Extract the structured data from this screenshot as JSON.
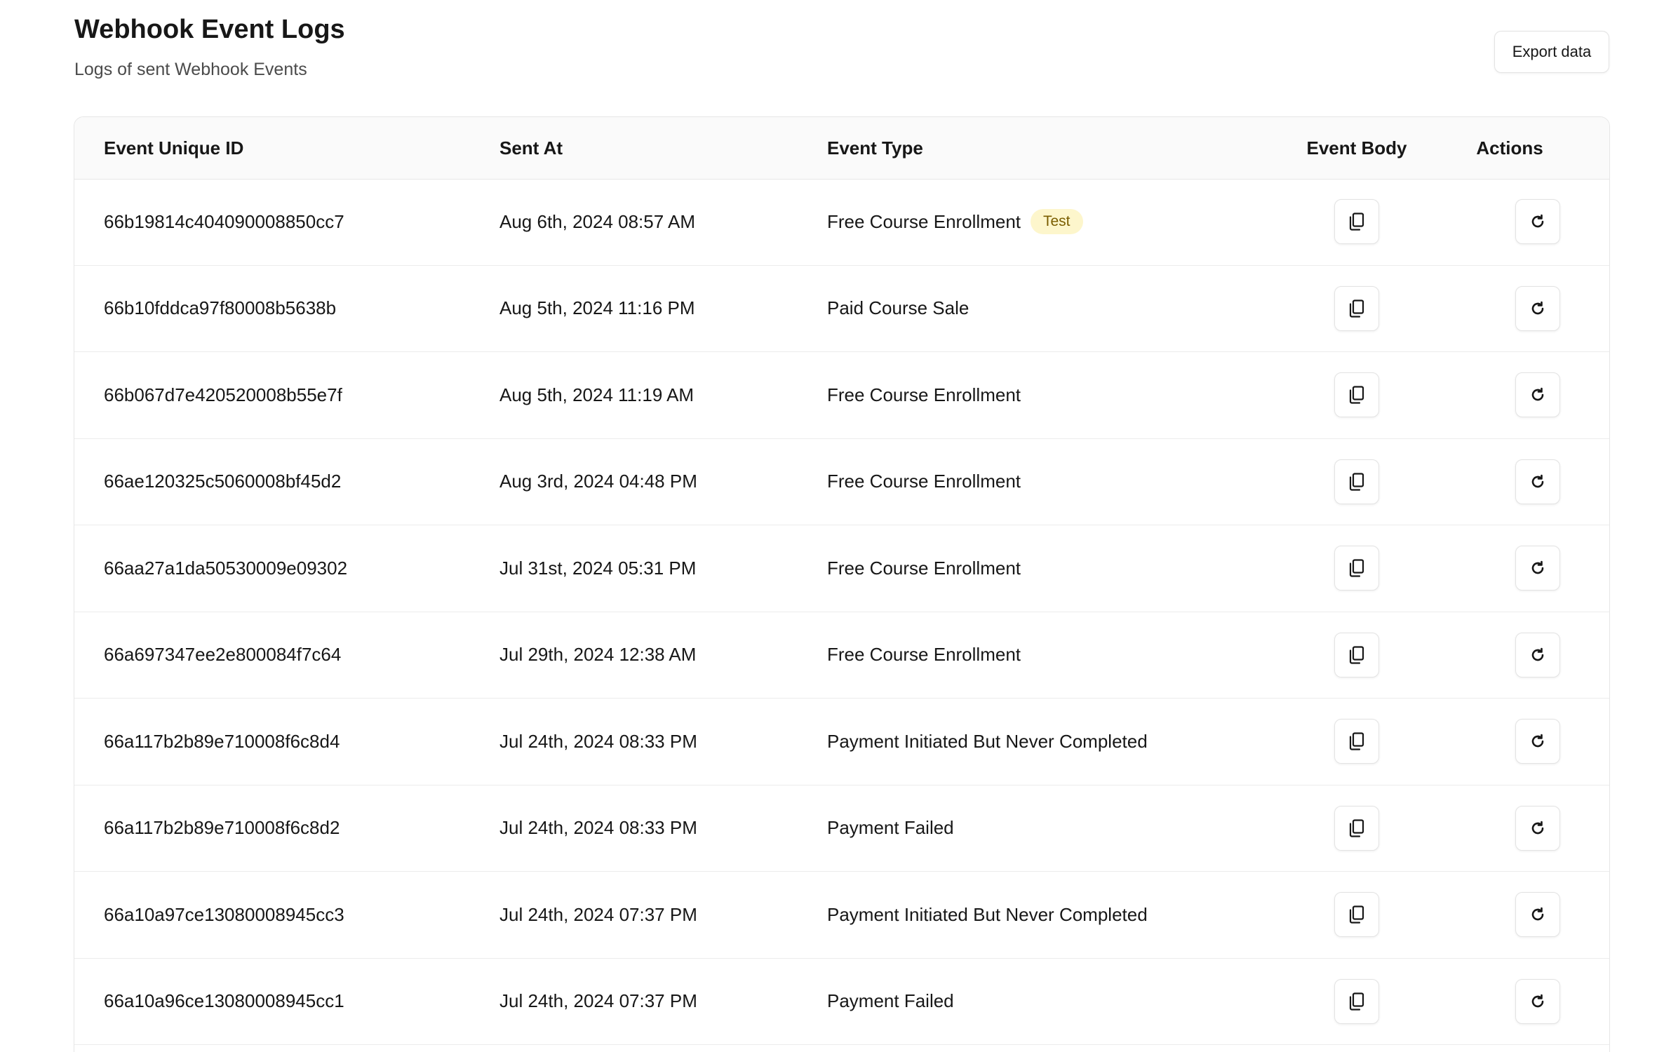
{
  "header": {
    "title": "Webhook Event Logs",
    "subtitle": "Logs of sent Webhook Events",
    "export_label": "Export data"
  },
  "table": {
    "columns": {
      "id": "Event Unique ID",
      "sent_at": "Sent At",
      "event_type": "Event Type",
      "event_body": "Event Body",
      "actions": "Actions"
    },
    "rows": [
      {
        "id": "66b19814c404090008850cc7",
        "sent_at": "Aug 6th, 2024 08:57 AM",
        "event_type": "Free Course Enrollment",
        "badge": "Test"
      },
      {
        "id": "66b10fddca97f80008b5638b",
        "sent_at": "Aug 5th, 2024 11:16 PM",
        "event_type": "Paid Course Sale",
        "badge": ""
      },
      {
        "id": "66b067d7e420520008b55e7f",
        "sent_at": "Aug 5th, 2024 11:19 AM",
        "event_type": "Free Course Enrollment",
        "badge": ""
      },
      {
        "id": "66ae120325c5060008bf45d2",
        "sent_at": "Aug 3rd, 2024 04:48 PM",
        "event_type": "Free Course Enrollment",
        "badge": ""
      },
      {
        "id": "66aa27a1da50530009e09302",
        "sent_at": "Jul 31st, 2024 05:31 PM",
        "event_type": "Free Course Enrollment",
        "badge": ""
      },
      {
        "id": "66a697347ee2e800084f7c64",
        "sent_at": "Jul 29th, 2024 12:38 AM",
        "event_type": "Free Course Enrollment",
        "badge": ""
      },
      {
        "id": "66a117b2b89e710008f6c8d4",
        "sent_at": "Jul 24th, 2024 08:33 PM",
        "event_type": "Payment Initiated But Never Completed",
        "badge": ""
      },
      {
        "id": "66a117b2b89e710008f6c8d2",
        "sent_at": "Jul 24th, 2024 08:33 PM",
        "event_type": "Payment Failed",
        "badge": ""
      },
      {
        "id": "66a10a97ce13080008945cc3",
        "sent_at": "Jul 24th, 2024 07:37 PM",
        "event_type": "Payment Initiated But Never Completed",
        "badge": ""
      },
      {
        "id": "66a10a96ce13080008945cc1",
        "sent_at": "Jul 24th, 2024 07:37 PM",
        "event_type": "Payment Failed",
        "badge": ""
      }
    ],
    "row_icons": {
      "event_body": "copy-icon",
      "actions": "refresh-icon"
    }
  },
  "colors": {
    "badge_bg": "#fdf6cc",
    "badge_text": "#7a5d00",
    "border": "#e6e6e6",
    "header_bg": "#fafafa"
  }
}
